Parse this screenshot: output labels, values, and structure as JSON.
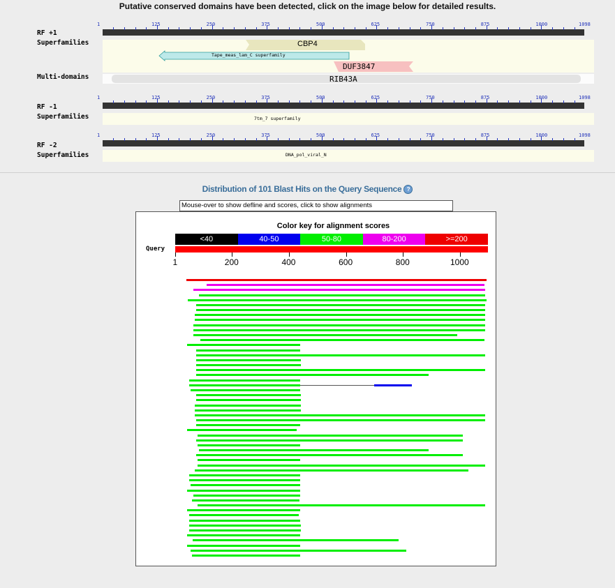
{
  "header": {
    "title": "Putative conserved domains have been detected, click on the image below for detailed results."
  },
  "cdd": {
    "ruler_ticks": [
      "1",
      "125",
      "250",
      "375",
      "500",
      "625",
      "750",
      "875",
      "1000",
      "1098"
    ],
    "frames": [
      {
        "frame_label": "RF +1",
        "row_label": "Superfamilies",
        "multi_label": "Multi-domains"
      },
      {
        "frame_label": "RF -1",
        "row_label": "Superfamilies"
      },
      {
        "frame_label": "RF -2",
        "row_label": "Superfamilies"
      }
    ],
    "domains": {
      "cbp4": "CBP4",
      "tape": "Tape_meas_lam_C superfamily",
      "duf": "DUF3847",
      "rib": "RIB43A",
      "tm7": "7tm_7 superfamily",
      "polv": "DNA_pol_viral_N"
    },
    "colors": {
      "cbp4": "#e8e6be",
      "tape": "#bde9e9",
      "duf": "#f7c0c0",
      "rib": "#e3e3e3",
      "tm7": "#bde9e9",
      "polv": "#ddcaf0",
      "ruler": "#333333",
      "ticks": "#2233bb"
    }
  },
  "blast": {
    "title": "Distribution of 101 Blast Hits on the Query Sequence",
    "help_icon": "help-icon",
    "defline_placeholder": "Mouse-over to show defline and scores, click to show alignments",
    "key_title": "Color key for alignment scores",
    "key": [
      {
        "label": "<40",
        "color": "#000000"
      },
      {
        "label": "40-50",
        "color": "#0000ee"
      },
      {
        "label": "50-80",
        "color": "#00ee00"
      },
      {
        "label": "80-200",
        "color": "#ee00ee"
      },
      {
        "label": ">=200",
        "color": "#ee0000"
      }
    ],
    "query_label": "Query",
    "query_length": 1098,
    "axis_labels": [
      "1",
      "200",
      "400",
      "600",
      "800",
      "1000"
    ],
    "hits": [
      {
        "start": 40,
        "end": 1092,
        "score": ">=200"
      },
      {
        "start": 110,
        "end": 1085,
        "score": "80-200"
      },
      {
        "start": 65,
        "end": 1088,
        "score": "80-200"
      },
      {
        "start": 85,
        "end": 1088,
        "score": "50-80"
      },
      {
        "start": 45,
        "end": 1092,
        "score": "50-80"
      },
      {
        "start": 75,
        "end": 1088,
        "score": "50-80"
      },
      {
        "start": 75,
        "end": 1088,
        "score": "50-80"
      },
      {
        "start": 70,
        "end": 1088,
        "score": "50-80"
      },
      {
        "start": 70,
        "end": 1088,
        "score": "50-80"
      },
      {
        "start": 65,
        "end": 1088,
        "score": "50-80"
      },
      {
        "start": 65,
        "end": 1088,
        "score": "50-80"
      },
      {
        "start": 65,
        "end": 990,
        "score": "50-80"
      },
      {
        "start": 90,
        "end": 1085,
        "score": "50-80"
      },
      {
        "start": 42,
        "end": 440,
        "score": "50-80"
      },
      {
        "start": 75,
        "end": 440,
        "score": "50-80"
      },
      {
        "start": 75,
        "end": 1088,
        "score": "50-80"
      },
      {
        "start": 75,
        "end": 442,
        "score": "50-80"
      },
      {
        "start": 75,
        "end": 442,
        "score": "50-80"
      },
      {
        "start": 75,
        "end": 1088,
        "score": "50-80"
      },
      {
        "start": 75,
        "end": 890,
        "score": "50-80"
      },
      {
        "start": 50,
        "end": 440,
        "score": "50-80"
      },
      {
        "start": 50,
        "end": 440,
        "score": "50-80",
        "gap_end": 700,
        "extra_start": 700,
        "extra_end": 830,
        "extra_score": "40-50"
      },
      {
        "start": 55,
        "end": 440,
        "score": "50-80"
      },
      {
        "start": 75,
        "end": 442,
        "score": "50-80"
      },
      {
        "start": 75,
        "end": 442,
        "score": "50-80"
      },
      {
        "start": 70,
        "end": 442,
        "score": "50-80"
      },
      {
        "start": 70,
        "end": 442,
        "score": "50-80"
      },
      {
        "start": 70,
        "end": 1088,
        "score": "50-80"
      },
      {
        "start": 75,
        "end": 1088,
        "score": "50-80"
      },
      {
        "start": 75,
        "end": 440,
        "score": "50-80"
      },
      {
        "start": 42,
        "end": 426,
        "score": "50-80"
      },
      {
        "start": 80,
        "end": 1010,
        "score": "50-80"
      },
      {
        "start": 75,
        "end": 1010,
        "score": "50-80"
      },
      {
        "start": 80,
        "end": 440,
        "score": "50-80"
      },
      {
        "start": 85,
        "end": 890,
        "score": "50-80"
      },
      {
        "start": 75,
        "end": 1010,
        "score": "50-80"
      },
      {
        "start": 80,
        "end": 440,
        "score": "50-80"
      },
      {
        "start": 80,
        "end": 1088,
        "score": "50-80"
      },
      {
        "start": 70,
        "end": 1030,
        "score": "50-80"
      },
      {
        "start": 50,
        "end": 440,
        "score": "50-80"
      },
      {
        "start": 50,
        "end": 440,
        "score": "50-80"
      },
      {
        "start": 55,
        "end": 440,
        "score": "50-80"
      },
      {
        "start": 42,
        "end": 440,
        "score": "50-80"
      },
      {
        "start": 65,
        "end": 440,
        "score": "50-80"
      },
      {
        "start": 60,
        "end": 438,
        "score": "50-80"
      },
      {
        "start": 80,
        "end": 1088,
        "score": "50-80"
      },
      {
        "start": 42,
        "end": 440,
        "score": "50-80"
      },
      {
        "start": 50,
        "end": 434,
        "score": "50-80"
      },
      {
        "start": 50,
        "end": 440,
        "score": "50-80"
      },
      {
        "start": 50,
        "end": 442,
        "score": "50-80"
      },
      {
        "start": 50,
        "end": 442,
        "score": "50-80"
      },
      {
        "start": 42,
        "end": 440,
        "score": "50-80"
      },
      {
        "start": 62,
        "end": 785,
        "score": "50-80"
      },
      {
        "start": 42,
        "end": 440,
        "score": "50-80"
      },
      {
        "start": 55,
        "end": 812,
        "score": "50-80"
      },
      {
        "start": 60,
        "end": 440,
        "score": "50-80"
      }
    ]
  }
}
